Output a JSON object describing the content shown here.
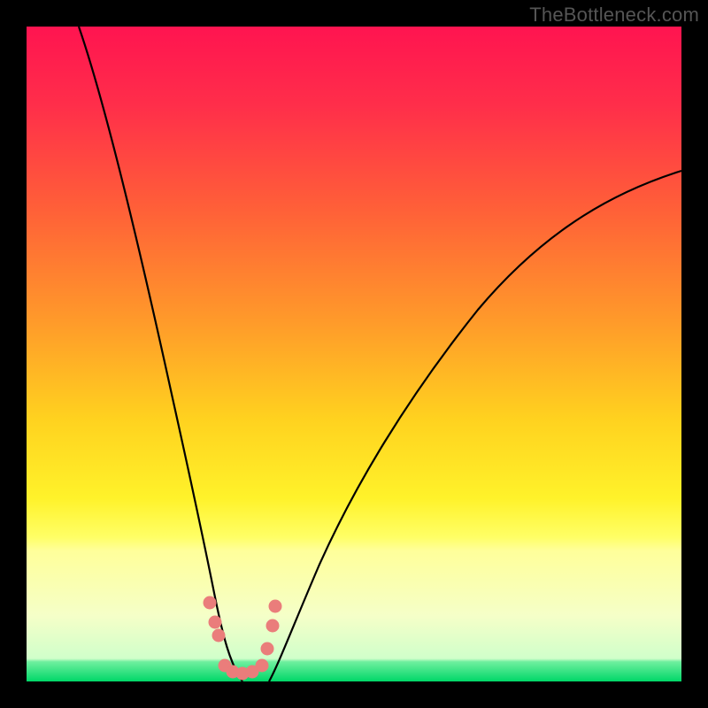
{
  "watermark": "TheBottleneck.com",
  "chart_data": {
    "type": "line",
    "title": "",
    "xlabel": "",
    "ylabel": "",
    "xlim": [
      0,
      100
    ],
    "ylim": [
      0,
      100
    ],
    "background_gradient": {
      "top_color": "#ff1a4f",
      "mid_colors": [
        "#ff7a33",
        "#ffd633",
        "#ffff66",
        "#f5ffb0"
      ],
      "bottom_color": "#00e070"
    },
    "series": [
      {
        "name": "left-curve",
        "x": [
          8,
          10,
          12,
          14,
          16,
          18,
          20,
          22,
          24,
          26,
          28,
          29,
          30,
          31,
          32,
          33
        ],
        "values": [
          100,
          90,
          80,
          70,
          60,
          51,
          42,
          34,
          27,
          20,
          14,
          10,
          6,
          3,
          1,
          0
        ]
      },
      {
        "name": "right-curve",
        "x": [
          37,
          38,
          40,
          43,
          47,
          52,
          58,
          65,
          73,
          82,
          92,
          100
        ],
        "values": [
          0,
          1,
          4,
          9,
          16,
          25,
          35,
          45,
          55,
          64,
          72,
          78
        ]
      },
      {
        "name": "marker-dots",
        "type": "scatter",
        "color": "#ea7d7b",
        "x": [
          28.0,
          28.8,
          29.3,
          30.2,
          31.5,
          33.0,
          34.5,
          36.0,
          36.8,
          37.5,
          37.9
        ],
        "values": [
          12.0,
          9.0,
          7.0,
          2.5,
          1.5,
          1.2,
          1.5,
          2.5,
          5.0,
          8.5,
          11.5
        ]
      }
    ],
    "green_band": {
      "y_start": 0,
      "y_end": 3,
      "color": "#00e070"
    },
    "pale_band": {
      "y_start": 3,
      "y_end": 22,
      "color_top": "#ffff9a",
      "color_bottom": "#d8ffc0"
    }
  }
}
